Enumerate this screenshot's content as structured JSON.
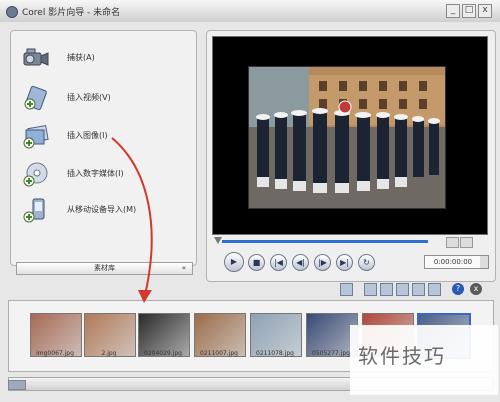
{
  "window": {
    "title": "Corel 影片向导 - 未命名",
    "minimize_symbol": "_",
    "maximize_symbol": "□",
    "close_symbol": "x"
  },
  "capture_menu": {
    "items": [
      {
        "label": "捕获(A)",
        "icon": "camcorder-icon"
      },
      {
        "label": "插入视频(V)",
        "icon": "video-clip-icon"
      },
      {
        "label": "插入图像(I)",
        "icon": "image-icon"
      },
      {
        "label": "插入数字媒体(I)",
        "icon": "disc-icon"
      },
      {
        "label": "从移动设备导入(M)",
        "icon": "mobile-device-icon"
      }
    ]
  },
  "library_bar": {
    "label": "素材库",
    "arrow": "«"
  },
  "playback": {
    "play_symbol": "▶",
    "stop_symbol": "■",
    "home_symbol": "|◀",
    "prev_symbol": "◀|",
    "next_symbol": "|▶",
    "end_symbol": "▶|",
    "repeat_symbol": "↻",
    "timecode": "0:00:00:00"
  },
  "toolbar": {
    "help_symbol": "?",
    "close_symbol": "x"
  },
  "library": {
    "thumbnails": [
      {
        "label": "img0067.jpg",
        "color": "#a66a55"
      },
      {
        "label": "2.jpg",
        "color": "#b07a5a"
      },
      {
        "label": "0204029.jpg",
        "color": "#2b2b2b"
      },
      {
        "label": "0211007.jpg",
        "color": "#9c6c4a"
      },
      {
        "label": "0211078.jpg",
        "color": "#8ea2b6"
      },
      {
        "label": "0505277.jpg",
        "color": "#384a74"
      },
      {
        "label": "",
        "color": "#b0483a"
      },
      {
        "label": "",
        "color": "#4b5e8a"
      }
    ]
  },
  "watermark": {
    "text": "软件技巧"
  },
  "colors": {
    "annotation_arrow": "#d2382b",
    "scrub_track": "#2f6fd0"
  }
}
